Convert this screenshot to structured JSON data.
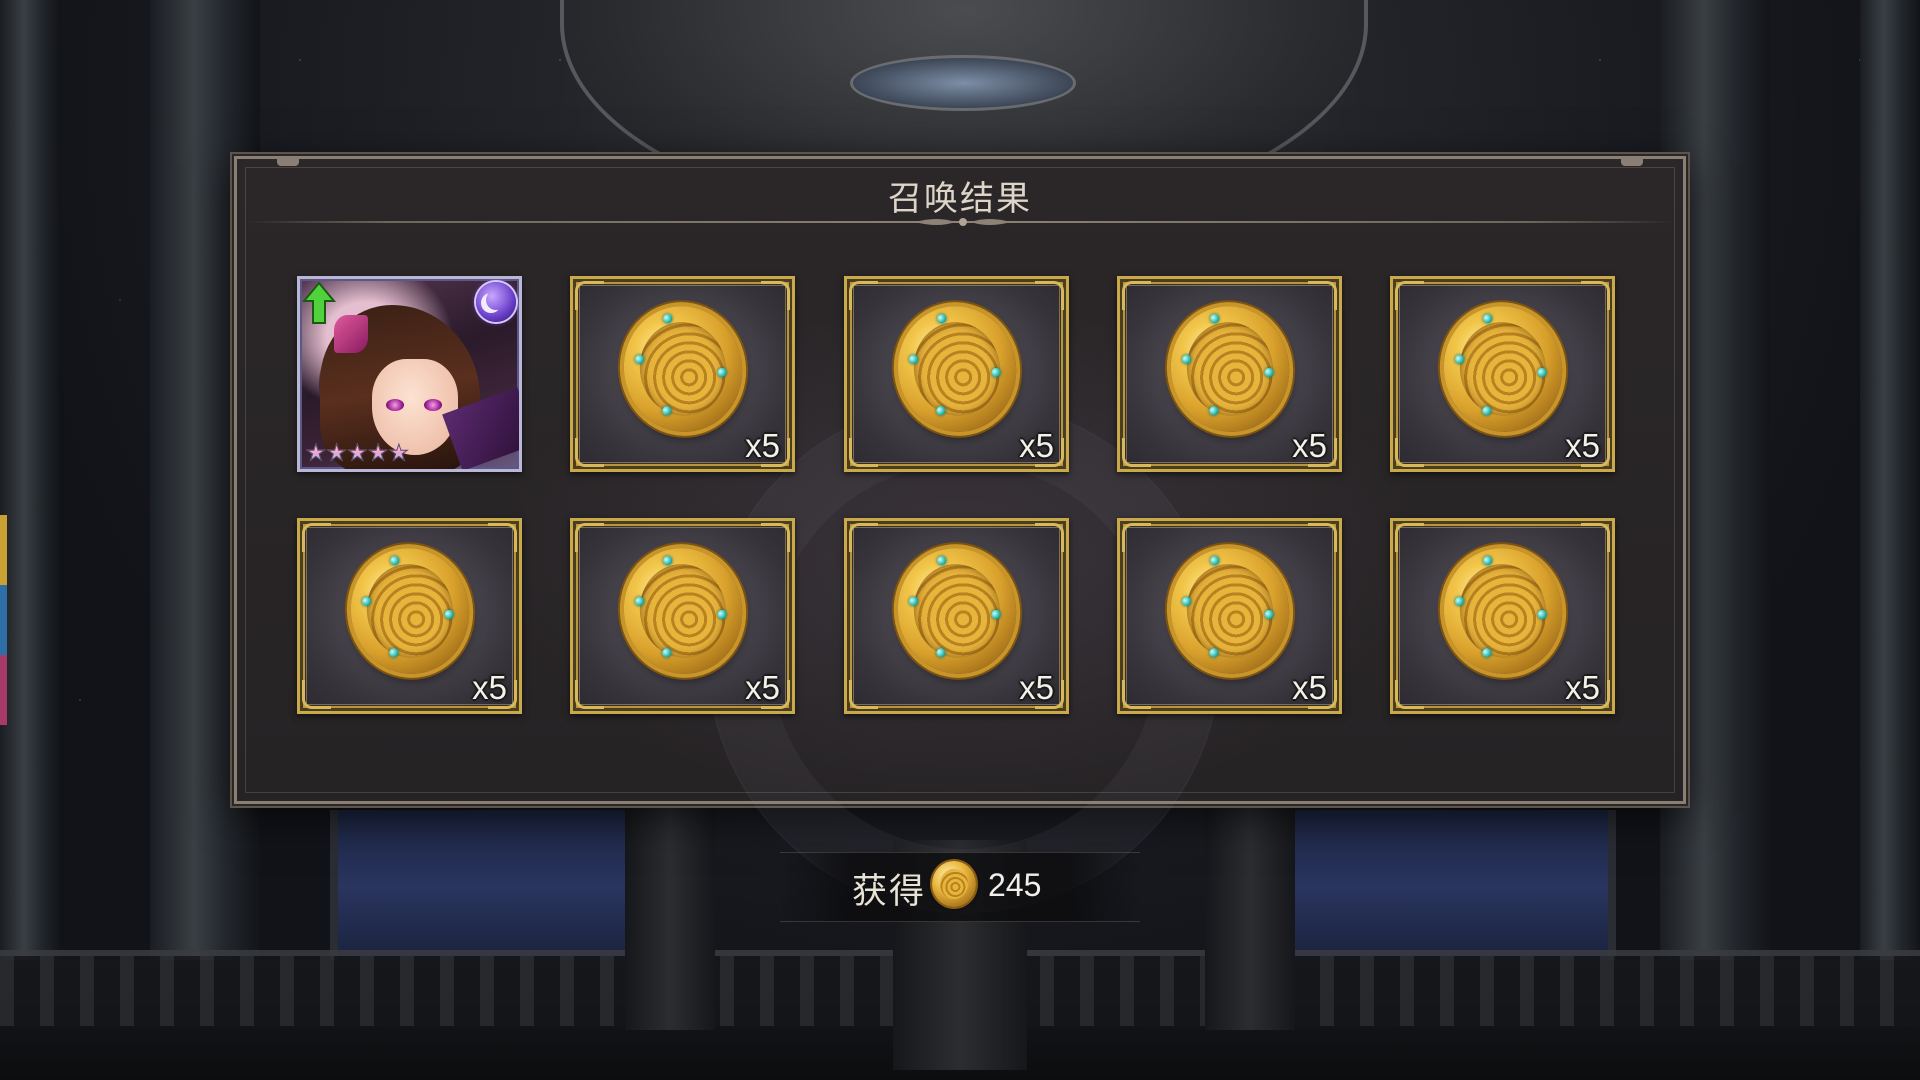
{
  "dialog": {
    "title": "召唤结果"
  },
  "results": [
    {
      "type": "character",
      "rarity_stars": 5,
      "attribute_icon": "moon-icon",
      "badge_icon": "level-up-arrow-icon"
    },
    {
      "type": "item",
      "icon": "golden-dragon-coin-icon",
      "quantity": "x5"
    },
    {
      "type": "item",
      "icon": "golden-dragon-coin-icon",
      "quantity": "x5"
    },
    {
      "type": "item",
      "icon": "golden-dragon-coin-icon",
      "quantity": "x5"
    },
    {
      "type": "item",
      "icon": "golden-dragon-coin-icon",
      "quantity": "x5"
    },
    {
      "type": "item",
      "icon": "golden-dragon-coin-icon",
      "quantity": "x5"
    },
    {
      "type": "item",
      "icon": "golden-dragon-coin-icon",
      "quantity": "x5"
    },
    {
      "type": "item",
      "icon": "golden-dragon-coin-icon",
      "quantity": "x5"
    },
    {
      "type": "item",
      "icon": "golden-dragon-coin-icon",
      "quantity": "x5"
    },
    {
      "type": "item",
      "icon": "golden-dragon-coin-icon",
      "quantity": "x5"
    }
  ],
  "obtained": {
    "label": "获得",
    "icon": "golden-dragon-coin-icon",
    "value": "245"
  },
  "colors": {
    "card_frame_gold": "#c9a94a",
    "dialog_bg": "#2b2729",
    "title_text": "#ddd6c8"
  }
}
